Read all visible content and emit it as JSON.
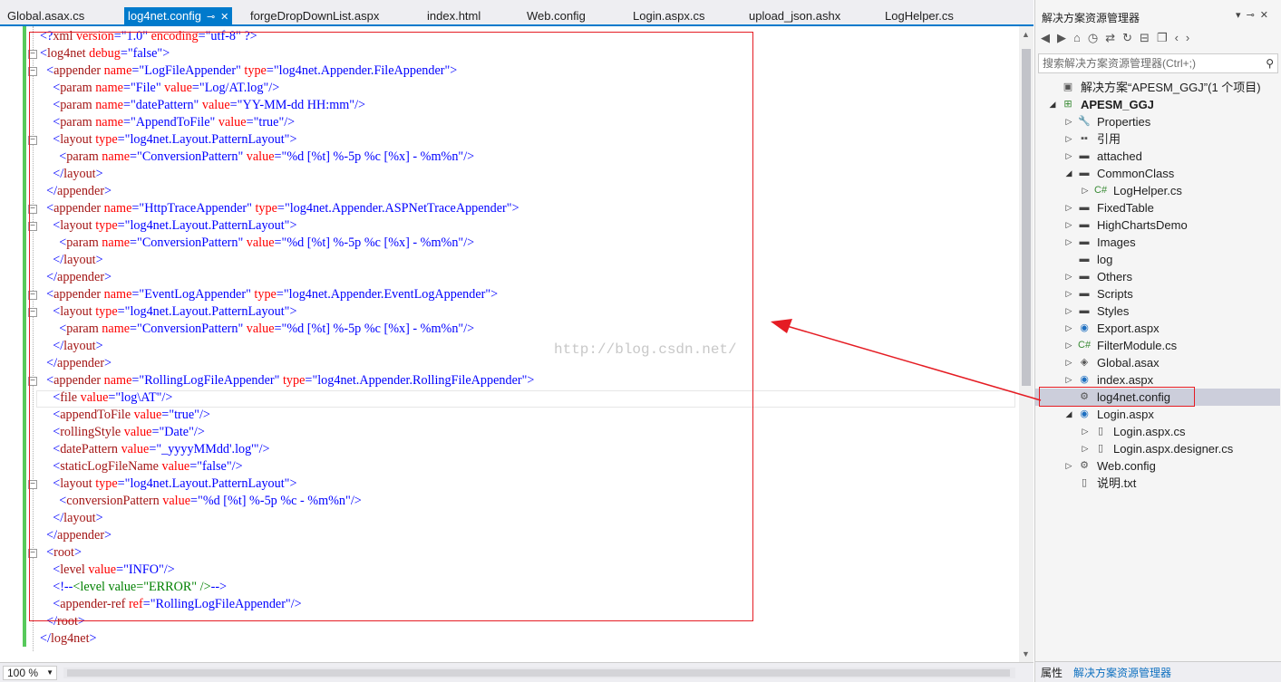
{
  "tabs": [
    {
      "label": "Global.asax.cs",
      "active": false
    },
    {
      "label": "log4net.config",
      "active": true
    },
    {
      "label": "forgeDropDownList.aspx",
      "active": false
    },
    {
      "label": "index.html",
      "active": false
    },
    {
      "label": "Web.config",
      "active": false
    },
    {
      "label": "Login.aspx.cs",
      "active": false
    },
    {
      "label": "upload_json.ashx",
      "active": false
    },
    {
      "label": "LogHelper.cs",
      "active": false
    }
  ],
  "tab_icons": {
    "pin": "pin-icon",
    "close": "close-icon"
  },
  "editor": {
    "lines": [
      [
        [
          "p",
          "<?"
        ],
        [
          "t",
          "xml"
        ],
        [
          "a",
          " version"
        ],
        [
          "p",
          "="
        ],
        [
          "v",
          "\"1.0\""
        ],
        [
          "a",
          " encoding"
        ],
        [
          "p",
          "="
        ],
        [
          "v",
          "\"utf-8\""
        ],
        [
          "p",
          " ?>"
        ]
      ],
      [
        [
          "p",
          "<"
        ],
        [
          "t",
          "log4net"
        ],
        [
          "a",
          " debug"
        ],
        [
          "p",
          "="
        ],
        [
          "v",
          "\"false\""
        ],
        [
          "p",
          ">"
        ]
      ],
      [
        [
          "x",
          "  "
        ],
        [
          "p",
          "<"
        ],
        [
          "t",
          "appender"
        ],
        [
          "a",
          " name"
        ],
        [
          "p",
          "="
        ],
        [
          "v",
          "\"LogFileAppender\""
        ],
        [
          "a",
          " type"
        ],
        [
          "p",
          "="
        ],
        [
          "v",
          "\"log4net.Appender.FileAppender\""
        ],
        [
          "p",
          ">"
        ]
      ],
      [
        [
          "x",
          "    "
        ],
        [
          "p",
          "<"
        ],
        [
          "t",
          "param"
        ],
        [
          "a",
          " name"
        ],
        [
          "p",
          "="
        ],
        [
          "v",
          "\"File\""
        ],
        [
          "a",
          " value"
        ],
        [
          "p",
          "="
        ],
        [
          "v",
          "\"Log/AT.log\""
        ],
        [
          "p",
          "/>"
        ]
      ],
      [
        [
          "x",
          "    "
        ],
        [
          "p",
          "<"
        ],
        [
          "t",
          "param"
        ],
        [
          "a",
          " name"
        ],
        [
          "p",
          "="
        ],
        [
          "v",
          "\"datePattern\""
        ],
        [
          "a",
          " value"
        ],
        [
          "p",
          "="
        ],
        [
          "v",
          "\"YY-MM-dd HH:mm\""
        ],
        [
          "p",
          "/>"
        ]
      ],
      [
        [
          "x",
          "    "
        ],
        [
          "p",
          "<"
        ],
        [
          "t",
          "param"
        ],
        [
          "a",
          " name"
        ],
        [
          "p",
          "="
        ],
        [
          "v",
          "\"AppendToFile\""
        ],
        [
          "a",
          " value"
        ],
        [
          "p",
          "="
        ],
        [
          "v",
          "\"true\""
        ],
        [
          "p",
          "/>"
        ]
      ],
      [
        [
          "x",
          "    "
        ],
        [
          "p",
          "<"
        ],
        [
          "t",
          "layout"
        ],
        [
          "a",
          " type"
        ],
        [
          "p",
          "="
        ],
        [
          "v",
          "\"log4net.Layout.PatternLayout\""
        ],
        [
          "p",
          ">"
        ]
      ],
      [
        [
          "x",
          "      "
        ],
        [
          "p",
          "<"
        ],
        [
          "t",
          "param"
        ],
        [
          "a",
          " name"
        ],
        [
          "p",
          "="
        ],
        [
          "v",
          "\"ConversionPattern\""
        ],
        [
          "a",
          " value"
        ],
        [
          "p",
          "="
        ],
        [
          "v",
          "\"%d [%t] %-5p %c [%x] - %m%n\""
        ],
        [
          "p",
          "/>"
        ]
      ],
      [
        [
          "x",
          "    "
        ],
        [
          "p",
          "</"
        ],
        [
          "t",
          "layout"
        ],
        [
          "p",
          ">"
        ]
      ],
      [
        [
          "x",
          "  "
        ],
        [
          "p",
          "</"
        ],
        [
          "t",
          "appender"
        ],
        [
          "p",
          ">"
        ]
      ],
      [
        [
          "x",
          "  "
        ],
        [
          "p",
          "<"
        ],
        [
          "t",
          "appender"
        ],
        [
          "a",
          " name"
        ],
        [
          "p",
          "="
        ],
        [
          "v",
          "\"HttpTraceAppender\""
        ],
        [
          "a",
          " type"
        ],
        [
          "p",
          "="
        ],
        [
          "v",
          "\"log4net.Appender.ASPNetTraceAppender\""
        ],
        [
          "p",
          ">"
        ]
      ],
      [
        [
          "x",
          "    "
        ],
        [
          "p",
          "<"
        ],
        [
          "t",
          "layout"
        ],
        [
          "a",
          " type"
        ],
        [
          "p",
          "="
        ],
        [
          "v",
          "\"log4net.Layout.PatternLayout\""
        ],
        [
          "p",
          ">"
        ]
      ],
      [
        [
          "x",
          "      "
        ],
        [
          "p",
          "<"
        ],
        [
          "t",
          "param"
        ],
        [
          "a",
          " name"
        ],
        [
          "p",
          "="
        ],
        [
          "v",
          "\"ConversionPattern\""
        ],
        [
          "a",
          " value"
        ],
        [
          "p",
          "="
        ],
        [
          "v",
          "\"%d [%t] %-5p %c [%x] - %m%n\""
        ],
        [
          "p",
          "/>"
        ]
      ],
      [
        [
          "x",
          "    "
        ],
        [
          "p",
          "</"
        ],
        [
          "t",
          "layout"
        ],
        [
          "p",
          ">"
        ]
      ],
      [
        [
          "x",
          "  "
        ],
        [
          "p",
          "</"
        ],
        [
          "t",
          "appender"
        ],
        [
          "p",
          ">"
        ]
      ],
      [
        [
          "x",
          "  "
        ],
        [
          "p",
          "<"
        ],
        [
          "t",
          "appender"
        ],
        [
          "a",
          " name"
        ],
        [
          "p",
          "="
        ],
        [
          "v",
          "\"EventLogAppender\""
        ],
        [
          "a",
          " type"
        ],
        [
          "p",
          "="
        ],
        [
          "v",
          "\"log4net.Appender.EventLogAppender\""
        ],
        [
          "p",
          ">"
        ]
      ],
      [
        [
          "x",
          "    "
        ],
        [
          "p",
          "<"
        ],
        [
          "t",
          "layout"
        ],
        [
          "a",
          " type"
        ],
        [
          "p",
          "="
        ],
        [
          "v",
          "\"log4net.Layout.PatternLayout\""
        ],
        [
          "p",
          ">"
        ]
      ],
      [
        [
          "x",
          "      "
        ],
        [
          "p",
          "<"
        ],
        [
          "t",
          "param"
        ],
        [
          "a",
          " name"
        ],
        [
          "p",
          "="
        ],
        [
          "v",
          "\"ConversionPattern\""
        ],
        [
          "a",
          " value"
        ],
        [
          "p",
          "="
        ],
        [
          "v",
          "\"%d [%t] %-5p %c [%x] - %m%n\""
        ],
        [
          "p",
          "/>"
        ]
      ],
      [
        [
          "x",
          "    "
        ],
        [
          "p",
          "</"
        ],
        [
          "t",
          "layout"
        ],
        [
          "p",
          ">"
        ]
      ],
      [
        [
          "x",
          "  "
        ],
        [
          "p",
          "</"
        ],
        [
          "t",
          "appender"
        ],
        [
          "p",
          ">"
        ]
      ],
      [
        [
          "x",
          "  "
        ],
        [
          "p",
          "<"
        ],
        [
          "t",
          "appender"
        ],
        [
          "a",
          " name"
        ],
        [
          "p",
          "="
        ],
        [
          "v",
          "\"RollingLogFileAppender\""
        ],
        [
          "a",
          " type"
        ],
        [
          "p",
          "="
        ],
        [
          "v",
          "\"log4net.Appender.RollingFileAppender\""
        ],
        [
          "p",
          ">"
        ]
      ],
      [
        [
          "x",
          "    "
        ],
        [
          "p",
          "<"
        ],
        [
          "t",
          "file"
        ],
        [
          "a",
          " value"
        ],
        [
          "p",
          "="
        ],
        [
          "v",
          "\"log\\AT\""
        ],
        [
          "p",
          "/>"
        ]
      ],
      [
        [
          "x",
          "    "
        ],
        [
          "p",
          "<"
        ],
        [
          "t",
          "appendToFile"
        ],
        [
          "a",
          " value"
        ],
        [
          "p",
          "="
        ],
        [
          "v",
          "\"true\""
        ],
        [
          "p",
          "/>"
        ]
      ],
      [
        [
          "x",
          "    "
        ],
        [
          "p",
          "<"
        ],
        [
          "t",
          "rollingStyle"
        ],
        [
          "a",
          " value"
        ],
        [
          "p",
          "="
        ],
        [
          "v",
          "\"Date\""
        ],
        [
          "p",
          "/>"
        ]
      ],
      [
        [
          "x",
          "    "
        ],
        [
          "p",
          "<"
        ],
        [
          "t",
          "datePattern"
        ],
        [
          "a",
          " value"
        ],
        [
          "p",
          "="
        ],
        [
          "v",
          "\"_yyyyMMdd'.log'\""
        ],
        [
          "p",
          "/>"
        ]
      ],
      [
        [
          "x",
          "    "
        ],
        [
          "p",
          "<"
        ],
        [
          "t",
          "staticLogFileName"
        ],
        [
          "a",
          " value"
        ],
        [
          "p",
          "="
        ],
        [
          "v",
          "\"false\""
        ],
        [
          "p",
          "/>"
        ]
      ],
      [
        [
          "x",
          "    "
        ],
        [
          "p",
          "<"
        ],
        [
          "t",
          "layout"
        ],
        [
          "a",
          " type"
        ],
        [
          "p",
          "="
        ],
        [
          "v",
          "\"log4net.Layout.PatternLayout\""
        ],
        [
          "p",
          ">"
        ]
      ],
      [
        [
          "x",
          "      "
        ],
        [
          "p",
          "<"
        ],
        [
          "t",
          "conversionPattern"
        ],
        [
          "a",
          " value"
        ],
        [
          "p",
          "="
        ],
        [
          "v",
          "\"%d [%t] %-5p %c - %m%n\""
        ],
        [
          "p",
          "/>"
        ]
      ],
      [
        [
          "x",
          "    "
        ],
        [
          "p",
          "</"
        ],
        [
          "t",
          "layout"
        ],
        [
          "p",
          ">"
        ]
      ],
      [
        [
          "x",
          "  "
        ],
        [
          "p",
          "</"
        ],
        [
          "t",
          "appender"
        ],
        [
          "p",
          ">"
        ]
      ],
      [
        [
          "x",
          "  "
        ],
        [
          "p",
          "<"
        ],
        [
          "t",
          "root"
        ],
        [
          "p",
          ">"
        ]
      ],
      [
        [
          "x",
          "    "
        ],
        [
          "p",
          "<"
        ],
        [
          "t",
          "level"
        ],
        [
          "a",
          " value"
        ],
        [
          "p",
          "="
        ],
        [
          "v",
          "\"INFO\""
        ],
        [
          "p",
          "/>"
        ]
      ],
      [
        [
          "x",
          "    "
        ],
        [
          "p",
          "<!--"
        ],
        [
          "c",
          "<level value=\"ERROR\" />"
        ],
        [
          "p",
          "-->"
        ]
      ],
      [
        [
          "x",
          "    "
        ],
        [
          "p",
          "<"
        ],
        [
          "t",
          "appender-ref"
        ],
        [
          "a",
          " ref"
        ],
        [
          "p",
          "="
        ],
        [
          "v",
          "\"RollingLogFileAppender\""
        ],
        [
          "p",
          "/>"
        ]
      ],
      [
        [
          "x",
          "  "
        ],
        [
          "p",
          "</"
        ],
        [
          "t",
          "root"
        ],
        [
          "p",
          ">"
        ]
      ],
      [
        [
          "p",
          "</"
        ],
        [
          "t",
          "log4net"
        ],
        [
          "p",
          ">"
        ]
      ]
    ],
    "watermark": "http://blog.csdn.net/",
    "zoom": "100 %"
  },
  "solution_explorer": {
    "title": "解决方案资源管理器",
    "search_placeholder": "搜索解决方案资源管理器(Ctrl+;)",
    "toolbar_icons": [
      "back-icon",
      "forward-icon",
      "home-icon",
      "history-icon",
      "sync-icon",
      "refresh-icon",
      "collapse-icon",
      "copy-icon",
      "code-icon"
    ],
    "items": [
      {
        "label": "解决方案“APESM_GGJ”(1 个项目)",
        "depth": 0,
        "arrow": "",
        "icon": "solution-icon",
        "bold": false,
        "selected": false
      },
      {
        "label": "APESM_GGJ",
        "depth": 0,
        "arrow": "expanded",
        "icon": "web-project-icon",
        "bold": true,
        "selected": false
      },
      {
        "label": "Properties",
        "depth": 1,
        "arrow": "collapsed",
        "icon": "wrench-icon",
        "bold": false,
        "selected": false
      },
      {
        "label": "引用",
        "depth": 1,
        "arrow": "collapsed",
        "icon": "references-icon",
        "bold": false,
        "selected": false
      },
      {
        "label": "attached",
        "depth": 1,
        "arrow": "collapsed",
        "icon": "folder-icon",
        "bold": false,
        "selected": false
      },
      {
        "label": "CommonClass",
        "depth": 1,
        "arrow": "expanded",
        "icon": "folder-icon",
        "bold": false,
        "selected": false
      },
      {
        "label": "LogHelper.cs",
        "depth": 2,
        "arrow": "collapsed",
        "icon": "csharp-file-icon",
        "bold": false,
        "selected": false
      },
      {
        "label": "FixedTable",
        "depth": 1,
        "arrow": "collapsed",
        "icon": "folder-icon",
        "bold": false,
        "selected": false
      },
      {
        "label": "HighChartsDemo",
        "depth": 1,
        "arrow": "collapsed",
        "icon": "folder-icon",
        "bold": false,
        "selected": false
      },
      {
        "label": "Images",
        "depth": 1,
        "arrow": "collapsed",
        "icon": "folder-icon",
        "bold": false,
        "selected": false
      },
      {
        "label": "log",
        "depth": 1,
        "arrow": "",
        "icon": "folder-icon",
        "bold": false,
        "selected": false
      },
      {
        "label": "Others",
        "depth": 1,
        "arrow": "collapsed",
        "icon": "folder-icon",
        "bold": false,
        "selected": false
      },
      {
        "label": "Scripts",
        "depth": 1,
        "arrow": "collapsed",
        "icon": "folder-icon",
        "bold": false,
        "selected": false
      },
      {
        "label": "Styles",
        "depth": 1,
        "arrow": "collapsed",
        "icon": "folder-icon",
        "bold": false,
        "selected": false
      },
      {
        "label": "Export.aspx",
        "depth": 1,
        "arrow": "collapsed",
        "icon": "aspx-file-icon",
        "bold": false,
        "selected": false
      },
      {
        "label": "FilterModule.cs",
        "depth": 1,
        "arrow": "collapsed",
        "icon": "csharp-file-icon",
        "bold": false,
        "selected": false
      },
      {
        "label": "Global.asax",
        "depth": 1,
        "arrow": "collapsed",
        "icon": "global-file-icon",
        "bold": false,
        "selected": false
      },
      {
        "label": "index.aspx",
        "depth": 1,
        "arrow": "collapsed",
        "icon": "aspx-file-icon",
        "bold": false,
        "selected": false
      },
      {
        "label": "log4net.config",
        "depth": 1,
        "arrow": "",
        "icon": "config-file-icon",
        "bold": false,
        "selected": true
      },
      {
        "label": "Login.aspx",
        "depth": 1,
        "arrow": "expanded",
        "icon": "aspx-file-icon",
        "bold": false,
        "selected": false
      },
      {
        "label": "Login.aspx.cs",
        "depth": 2,
        "arrow": "collapsed",
        "icon": "code-file-icon",
        "bold": false,
        "selected": false
      },
      {
        "label": "Login.aspx.designer.cs",
        "depth": 2,
        "arrow": "collapsed",
        "icon": "code-file-icon",
        "bold": false,
        "selected": false
      },
      {
        "label": "Web.config",
        "depth": 1,
        "arrow": "collapsed",
        "icon": "config-file-icon",
        "bold": false,
        "selected": false
      },
      {
        "label": "说明.txt",
        "depth": 1,
        "arrow": "",
        "icon": "text-file-icon",
        "bold": false,
        "selected": false
      }
    ],
    "bottom_tabs": [
      "属性",
      "解决方案资源管理器"
    ]
  },
  "colors": {
    "accent": "#007acc",
    "annotation_red": "#e51c23",
    "xml_tag": "#a31515",
    "xml_attr": "#ff0000",
    "xml_value": "#0000ff",
    "xml_comment": "#008000",
    "change_bar": "#57c95b"
  }
}
